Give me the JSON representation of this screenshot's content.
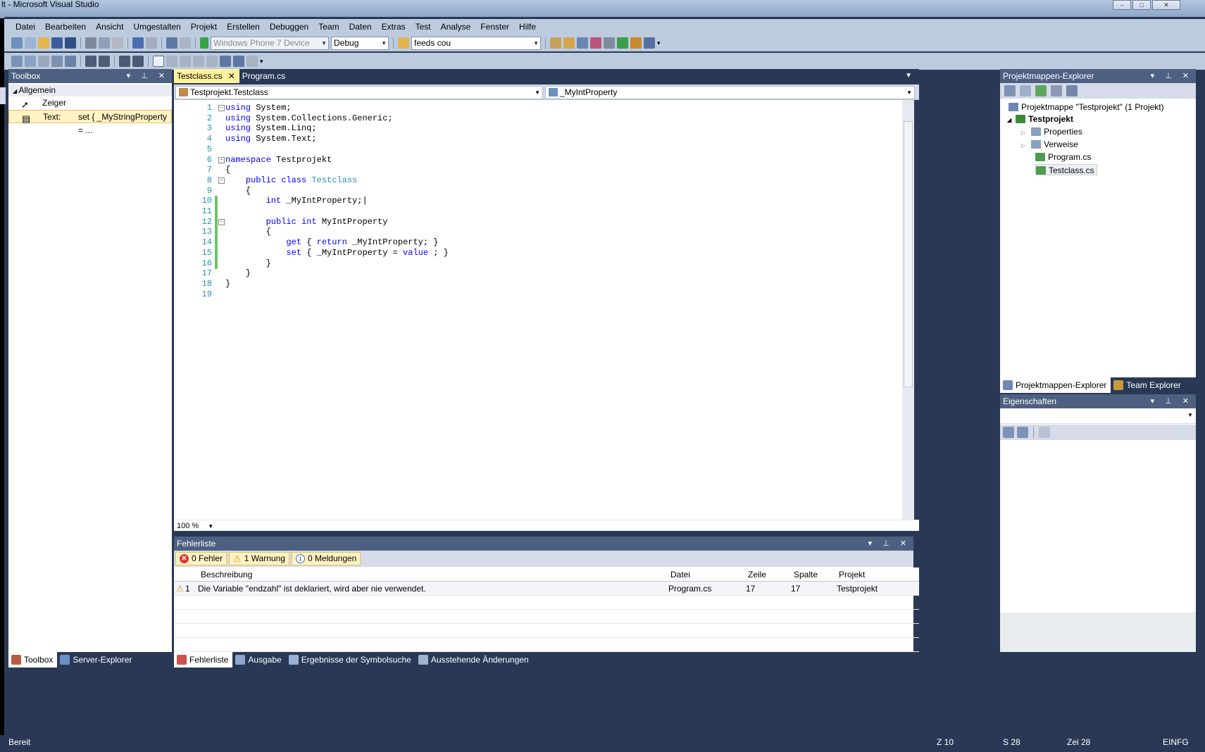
{
  "window": {
    "title": "lt - Microsoft Visual Studio"
  },
  "menu": [
    "Datei",
    "Bearbeiten",
    "Ansicht",
    "Umgestalten",
    "Projekt",
    "Erstellen",
    "Debuggen",
    "Team",
    "Daten",
    "Extras",
    "Test",
    "Analyse",
    "Fenster",
    "Hilfe"
  ],
  "toolbar": {
    "device": "Windows Phone 7 Device",
    "config": "Debug",
    "find": "feeds cou"
  },
  "toolbox": {
    "title": "Toolbox",
    "group": "Allgemein",
    "items": [
      {
        "label": "Zeiger",
        "value": ""
      },
      {
        "label": "Text:",
        "value": "set { _MyStringProperty = ..."
      }
    ],
    "tabs": [
      "Toolbox",
      "Server-Explorer"
    ]
  },
  "editor": {
    "tabs": [
      "Testclass.cs",
      "Program.cs"
    ],
    "nav_left": "Testprojekt.Testclass",
    "nav_right": "_MyIntProperty",
    "zoom": "100 %",
    "lines": [
      {
        "n": "1",
        "t": [
          [
            "kw",
            "using"
          ],
          [
            "",
            "System;"
          ]
        ]
      },
      {
        "n": "2",
        "t": [
          [
            "kw",
            "using"
          ],
          [
            "",
            "System.Collections.Generic;"
          ]
        ]
      },
      {
        "n": "3",
        "t": [
          [
            "kw",
            "using"
          ],
          [
            "",
            "System.Linq;"
          ]
        ]
      },
      {
        "n": "4",
        "t": [
          [
            "kw",
            "using"
          ],
          [
            "",
            "System.Text;"
          ]
        ]
      },
      {
        "n": "5",
        "t": []
      },
      {
        "n": "6",
        "t": [
          [
            "kw",
            "namespace"
          ],
          [
            "",
            "Testprojekt"
          ]
        ]
      },
      {
        "n": "7",
        "t": [
          [
            "",
            "{"
          ]
        ]
      },
      {
        "n": "8",
        "t": [
          [
            "",
            "    "
          ],
          [
            "kw",
            "public"
          ],
          [
            "kw",
            "class"
          ],
          [
            "ty",
            "Testclass"
          ]
        ]
      },
      {
        "n": "9",
        "t": [
          [
            "",
            "    {"
          ]
        ]
      },
      {
        "n": "10",
        "t": [
          [
            "",
            "        "
          ],
          [
            "kw",
            "int"
          ],
          [
            "",
            "_MyIntProperty;"
          ]
        ]
      },
      {
        "n": "11",
        "t": []
      },
      {
        "n": "12",
        "t": [
          [
            "",
            "        "
          ],
          [
            "kw",
            "public"
          ],
          [
            "kw",
            "int"
          ],
          [
            "",
            "MyIntProperty"
          ]
        ]
      },
      {
        "n": "13",
        "t": [
          [
            "",
            "        {"
          ]
        ]
      },
      {
        "n": "14",
        "t": [
          [
            "",
            "            "
          ],
          [
            "kw",
            "get"
          ],
          [
            "",
            "{"
          ],
          [
            "kw",
            "return"
          ],
          [
            "",
            "_MyIntProperty; }"
          ]
        ]
      },
      {
        "n": "15",
        "t": [
          [
            "",
            "            "
          ],
          [
            "kw",
            "set"
          ],
          [
            "",
            "{ _MyIntProperty ="
          ],
          [
            "kw",
            "value"
          ],
          [
            "",
            "; }"
          ]
        ]
      },
      {
        "n": "16",
        "t": [
          [
            "",
            "        }"
          ]
        ]
      },
      {
        "n": "17",
        "t": [
          [
            "",
            "    }"
          ]
        ]
      },
      {
        "n": "18",
        "t": [
          [
            "",
            "}"
          ]
        ]
      },
      {
        "n": "19",
        "t": []
      }
    ]
  },
  "errorlist": {
    "title": "Fehlerliste",
    "filters": [
      "0 Fehler",
      "1 Warnung",
      "0 Meldungen"
    ],
    "columns": [
      "Beschreibung",
      "Datei",
      "Zeile",
      "Spalte",
      "Projekt"
    ],
    "rows": [
      {
        "num": "1",
        "desc": "Die Variable \"endzahl\" ist deklariert, wird aber nie verwendet.",
        "file": "Program.cs",
        "line": "17",
        "col": "17",
        "project": "Testprojekt"
      }
    ]
  },
  "bottomtabs": [
    "Fehlerliste",
    "Ausgabe",
    "Ergebnisse der Symbolsuche",
    "Ausstehende Änderungen"
  ],
  "solution": {
    "title": "Projektmappen-Explorer",
    "root": "Projektmappe \"Testprojekt\" (1 Projekt)",
    "project": "Testprojekt",
    "items": [
      "Properties",
      "Verweise",
      "Program.cs",
      "Testclass.cs"
    ],
    "tabs": [
      "Projektmappen-Explorer",
      "Team Explorer"
    ]
  },
  "properties": {
    "title": "Eigenschaften"
  },
  "status": {
    "left": "Bereit",
    "z": "Z 10",
    "s": "S 28",
    "zei": "Zei 28",
    "mode": "EINFG"
  }
}
